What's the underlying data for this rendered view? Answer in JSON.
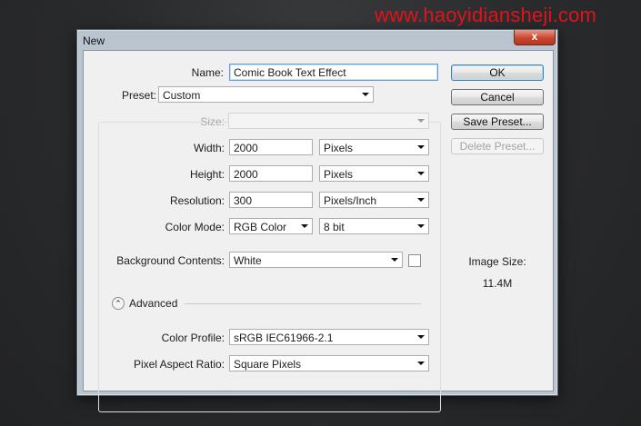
{
  "watermark": "www.haoyidiansheji.com",
  "dialog": {
    "title": "New",
    "close_symbol": "x"
  },
  "form": {
    "name_label": "Name:",
    "name_value": "Comic Book Text Effect",
    "preset_label": "Preset:",
    "preset_value": "Custom",
    "size_label": "Size:",
    "size_value": "",
    "width_label": "Width:",
    "width_value": "2000",
    "width_unit": "Pixels",
    "height_label": "Height:",
    "height_value": "2000",
    "height_unit": "Pixels",
    "resolution_label": "Resolution:",
    "resolution_value": "300",
    "resolution_unit": "Pixels/Inch",
    "color_mode_label": "Color Mode:",
    "color_mode_value": "RGB Color",
    "bit_depth_value": "8 bit",
    "background_label": "Background Contents:",
    "background_value": "White",
    "advanced_label": "Advanced",
    "color_profile_label": "Color Profile:",
    "color_profile_value": "sRGB IEC61966-2.1",
    "pixel_aspect_label": "Pixel Aspect Ratio:",
    "pixel_aspect_value": "Square Pixels"
  },
  "buttons": {
    "ok": "OK",
    "cancel": "Cancel",
    "save_preset": "Save Preset...",
    "delete_preset": "Delete Preset..."
  },
  "image_size": {
    "label": "Image Size:",
    "value": "11.4M"
  },
  "icons": {
    "dropdown": "chevron-down-icon",
    "advanced_toggle": "collapse-up-icon",
    "close": "close-icon"
  },
  "colors": {
    "accent_focus": "#5f9ed8",
    "close_button": "#c9462f",
    "watermark": "#e0141c"
  }
}
